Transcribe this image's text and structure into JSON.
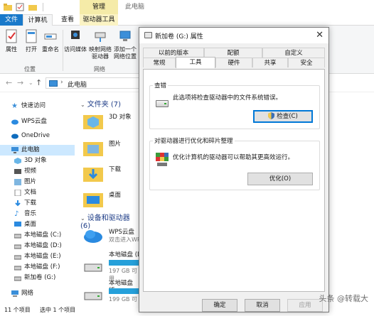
{
  "ribbon_context": {
    "manage": "管理",
    "title": "此电脑"
  },
  "ribbon_tabs": {
    "file": "文件",
    "computer": "计算机",
    "view": "查看",
    "drive_tools": "驱动器工具"
  },
  "ribbon": {
    "properties": "属性",
    "open": "打开",
    "rename": "重命名",
    "media_line1": "访问媒体",
    "network_drive_line1": "映射网络",
    "network_drive_line2": "驱动器",
    "network_location_line1": "添加一个",
    "network_location_line2": "网络位置",
    "group_location": "位置",
    "group_network": "网络"
  },
  "address": {
    "path": "此电脑"
  },
  "nav": {
    "quick_access": "快速访问",
    "wps": "WPS云盘",
    "onedrive": "OneDrive",
    "this_pc": "此电脑",
    "objects3d": "3D 对象",
    "videos": "视频",
    "pictures": "图片",
    "documents": "文档",
    "downloads": "下载",
    "music": "音乐",
    "desktop": "桌面",
    "disk_c": "本地磁盘 (C:)",
    "disk_d": "本地磁盘 (D:)",
    "disk_e": "本地磁盘 (E:)",
    "disk_f": "本地磁盘 (F:)",
    "disk_g": "新加卷 (G:)",
    "network": "网络"
  },
  "content": {
    "folders_head": "文件夹 (7)",
    "f_3d": "3D 对象",
    "f_pictures": "图片",
    "f_downloads": "下载",
    "f_desktop": "桌面",
    "devices_head": "设备和驱动器 (6)",
    "wps_name": "WPS云盘",
    "wps_sub": "双击进入WP",
    "disk_d_name": "本地磁盘 (D",
    "disk_d_free": "197 GB 可用",
    "disk_f_name": "本地磁盘 (F:",
    "disk_f_free": "199 GB 可用"
  },
  "status": {
    "count": "11 个项目",
    "selected": "选中 1 个项目"
  },
  "dialog": {
    "title": "新加卷 (G:) 属性",
    "close": "✕",
    "tabs_row1": [
      "以前的版本",
      "配额",
      "自定义"
    ],
    "tabs_row2": [
      "常规",
      "工具",
      "硬件",
      "共享",
      "安全"
    ],
    "check_title": "查错",
    "check_desc": "此选项将检查驱动器中的文件系统错误。",
    "check_button": "检查(C)",
    "optimize_title": "对驱动器进行优化和碎片整理",
    "optimize_desc": "优化计算机的驱动器可以帮助其更高效运行。",
    "optimize_button": "优化(O)",
    "ok": "确定",
    "cancel": "取消",
    "apply": "应用"
  },
  "watermark": "头条 @转载大"
}
